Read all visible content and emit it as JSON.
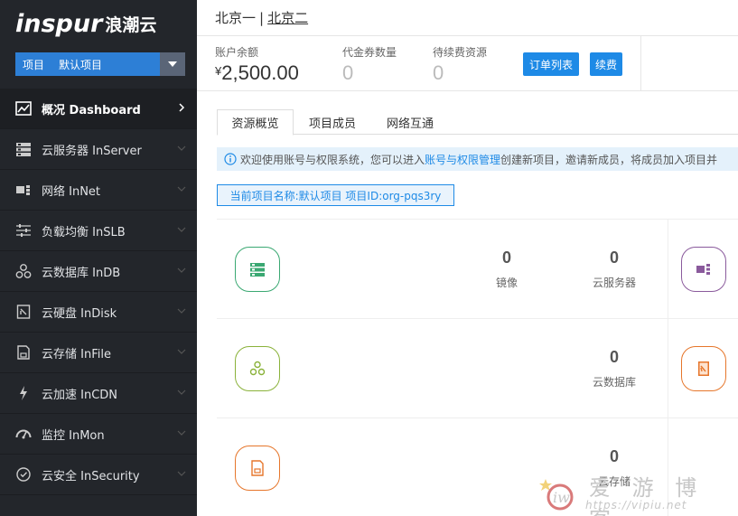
{
  "brand": {
    "logo_en": "inspur",
    "logo_cn": "浪潮云"
  },
  "project_select": {
    "label": "项目",
    "value": "默认项目"
  },
  "menu": [
    {
      "label": "概况 Dashboard",
      "icon": "dashboard-icon",
      "active": true
    },
    {
      "label": "云服务器 InServer",
      "icon": "server-icon"
    },
    {
      "label": "网络 InNet",
      "icon": "network-icon"
    },
    {
      "label": "负载均衡 InSLB",
      "icon": "slider-icon"
    },
    {
      "label": "云数据库 InDB",
      "icon": "database-icon"
    },
    {
      "label": "云硬盘 InDisk",
      "icon": "disk-icon"
    },
    {
      "label": "云存储 InFile",
      "icon": "file-icon"
    },
    {
      "label": "云加速 InCDN",
      "icon": "lightning-icon"
    },
    {
      "label": "监控 InMon",
      "icon": "gauge-icon"
    },
    {
      "label": "云安全 InSecurity",
      "icon": "security-icon"
    }
  ],
  "header": {
    "region_1": "北京一",
    "separator": "|",
    "region_2": "北京二"
  },
  "stats": {
    "balance_label": "账户余额",
    "balance_currency": "¥",
    "balance_value": "2,500.00",
    "voucher_label": "代金券数量",
    "voucher_value": "0",
    "pending_label": "待续费资源",
    "pending_value": "0",
    "orders_button": "订单列表",
    "renew_button": "续费"
  },
  "tabs": [
    "资源概览",
    "项目成员",
    "网络互通"
  ],
  "info": {
    "text_before": "欢迎使用账号与权限系统，您可以进入",
    "link": "账号与权限管理",
    "text_after": "创建新项目，邀请新成员，将成员加入项目并"
  },
  "project_tag": "当前项目名称:默认项目 项目ID:org-pqs3ry",
  "resources": {
    "row1": {
      "image_count": "0",
      "image_label": "镜像",
      "server_count": "0",
      "server_label": "云服务器"
    },
    "row2": {
      "db_count": "0",
      "db_label": "云数据库"
    },
    "row3": {
      "storage_count": "0",
      "storage_label": "云存储"
    }
  },
  "watermark": {
    "text": "爱 游 博 客",
    "url": "https://vipiu.net"
  },
  "colors": {
    "sidebar": "#23262b",
    "accent": "#1e8ae6",
    "green": "#3aa872",
    "olive": "#8ab23a",
    "orange": "#e6762b",
    "purple": "#8a5a9c"
  }
}
